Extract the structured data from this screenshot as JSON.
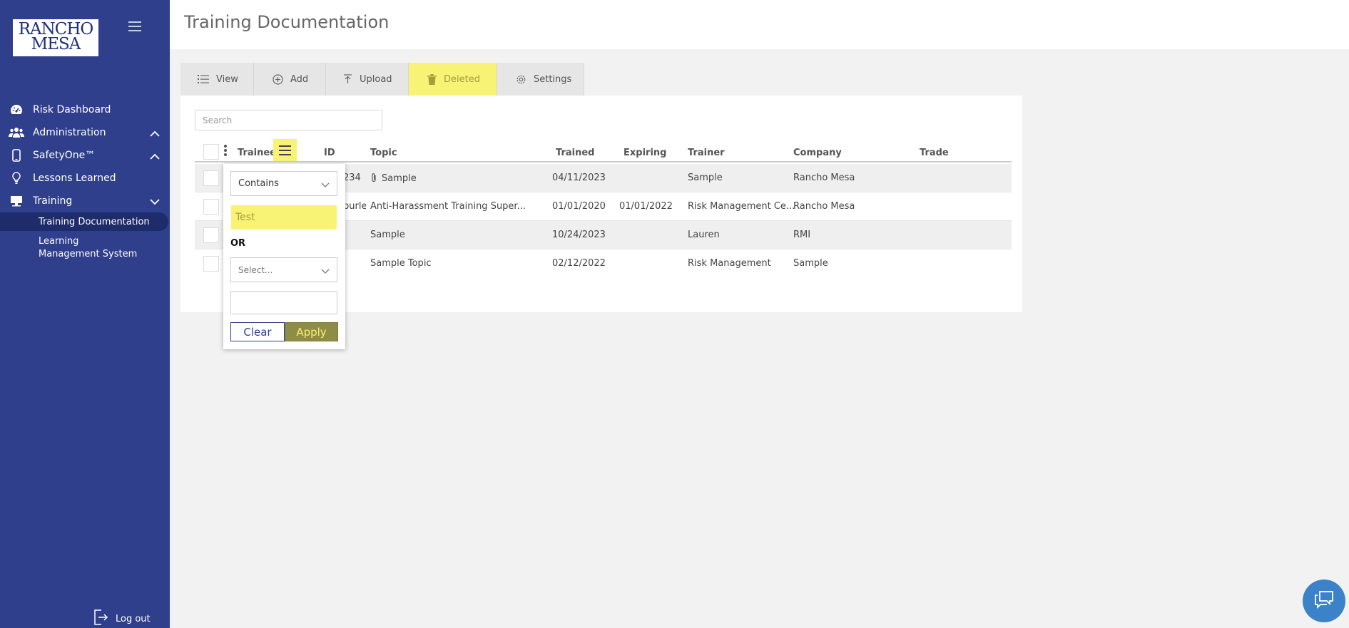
{
  "brand": {
    "line1": "RANCHO",
    "line2": "MESA"
  },
  "sidebar": {
    "items": [
      {
        "label": "Risk Dashboard",
        "icon": "dashboard-icon"
      },
      {
        "label": "Administration",
        "icon": "users-icon",
        "chevron": "chevron-up-icon"
      },
      {
        "label": "SafetyOne™",
        "icon": "mobile-icon",
        "chevron": "chevron-up-icon"
      },
      {
        "label": "Lessons Learned",
        "icon": "lightbulb-icon"
      },
      {
        "label": "Training",
        "icon": "monitor-icon",
        "chevron": "chevron-down-icon"
      }
    ],
    "subitems": [
      {
        "label": "Training Documentation",
        "active": true
      },
      {
        "label": "Learning Management System",
        "active": false
      }
    ],
    "logout_label": "Log out"
  },
  "header": {
    "title": "Training Documentation"
  },
  "tabs": [
    {
      "label": "View",
      "icon": "list-icon"
    },
    {
      "label": "Add",
      "icon": "plus-circle-icon"
    },
    {
      "label": "Upload",
      "icon": "upload-icon"
    },
    {
      "label": "Deleted",
      "icon": "trash-icon",
      "highlighted": true
    },
    {
      "label": "Settings",
      "icon": "gear-icon"
    }
  ],
  "search": {
    "placeholder": "Search",
    "value": ""
  },
  "table": {
    "columns": [
      "Trainee",
      "ID",
      "Topic",
      "Trained",
      "Expiring",
      "Trainer",
      "Company",
      "Trade"
    ],
    "rows": [
      {
        "id": "234",
        "topic": "Sample",
        "attachment": true,
        "trained": "04/11/2023",
        "expiring": "",
        "trainer": "Sample",
        "company": "Rancho Mesa",
        "trade": ""
      },
      {
        "id": "burley...",
        "topic": "Anti-Harassment Training Super...",
        "attachment": false,
        "trained": "01/01/2020",
        "expiring": "01/01/2022",
        "trainer": "Risk Management Ce...",
        "company": "Rancho Mesa",
        "trade": ""
      },
      {
        "id": "",
        "topic": "Sample",
        "attachment": false,
        "trained": "10/24/2023",
        "expiring": "",
        "trainer": "Lauren",
        "company": "RMI",
        "trade": ""
      },
      {
        "id": "",
        "topic": "Sample Topic",
        "attachment": false,
        "trained": "02/12/2022",
        "expiring": "",
        "trainer": "Risk Management",
        "company": "Sample",
        "trade": ""
      }
    ]
  },
  "filter": {
    "operator1": "Contains",
    "value1": "Test",
    "logic": "OR",
    "operator2_placeholder": "Select...",
    "value2": "",
    "clear_label": "Clear",
    "apply_label": "Apply"
  },
  "colors": {
    "sidebar": "#2f3f8c",
    "highlight": "#f8f275",
    "apply": "#8f8d45",
    "chat": "#3b82c8"
  }
}
